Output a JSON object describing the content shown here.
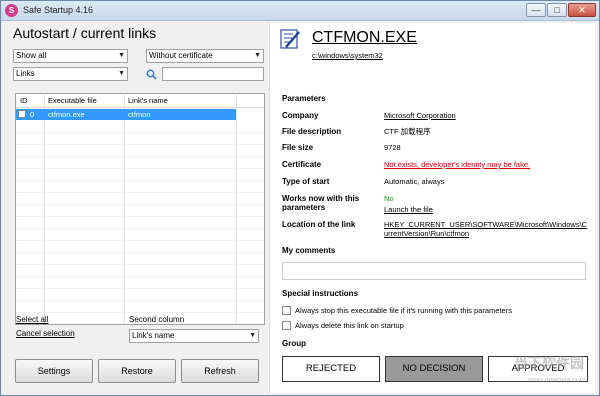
{
  "window": {
    "title": "Safe Startup 4.16",
    "icon_letter": "S",
    "min_glyph": "—",
    "max_glyph": "□",
    "close_glyph": "✕"
  },
  "left": {
    "heading": "Autostart / current links",
    "filter_show": "Show all",
    "filter_cert": "Without certificate",
    "filter_type": "Links",
    "search_placeholder": "",
    "table": {
      "columns": [
        "ID",
        "Executable file",
        "Link's name"
      ],
      "rows": [
        {
          "id": "0",
          "exe": "ctfmon.exe",
          "link": "ctfmon",
          "selected": true
        }
      ]
    },
    "select_all": "Select all",
    "cancel_selection": "Cancel selection",
    "second_column_label": "Second column",
    "second_column_value": "Link's name",
    "buttons": {
      "settings": "Settings",
      "restore": "Restore",
      "refresh": "Refresh"
    }
  },
  "right": {
    "exe_name": "CTFMON.EXE",
    "exe_path": "c:\\windows\\system32",
    "parameters_title": "Parameters",
    "params": {
      "company_label": "Company",
      "company_value": "Microsoft Corporation",
      "desc_label": "File description",
      "desc_value": "CTF 加载程序",
      "size_label": "File size",
      "size_value": "9728",
      "cert_label": "Certificate",
      "cert_value": "Not exists, developer's identity may be fake.",
      "start_label": "Type of start",
      "start_value": "Automatic, always",
      "works_label": "Works now with this parameters",
      "works_value": "No",
      "launch_link": "Launch the file",
      "location_label": "Location of the link",
      "location_value": "HKEY_CURRENT_USER\\SOFTWARE\\Microsoft\\Windows\\CurrentVersion\\Run\\ctfmon"
    },
    "comments_title": "My comments",
    "special_title": "Special instructions",
    "instr1": "Always stop this executable file if it's running with this parameters",
    "instr2": "Always delete this link on startup",
    "group_title": "Group",
    "group_buttons": {
      "rejected": "REJECTED",
      "no_decision": "NO DECISION",
      "approved": "APPROVED"
    },
    "watermark": "当下软件园",
    "watermark_url": "www.downxia.com"
  },
  "colors": {
    "selection": "#3399ff",
    "warning": "#e00000",
    "ok": "#1f9a1f",
    "no_decision_bg": "#9a9a9a"
  }
}
